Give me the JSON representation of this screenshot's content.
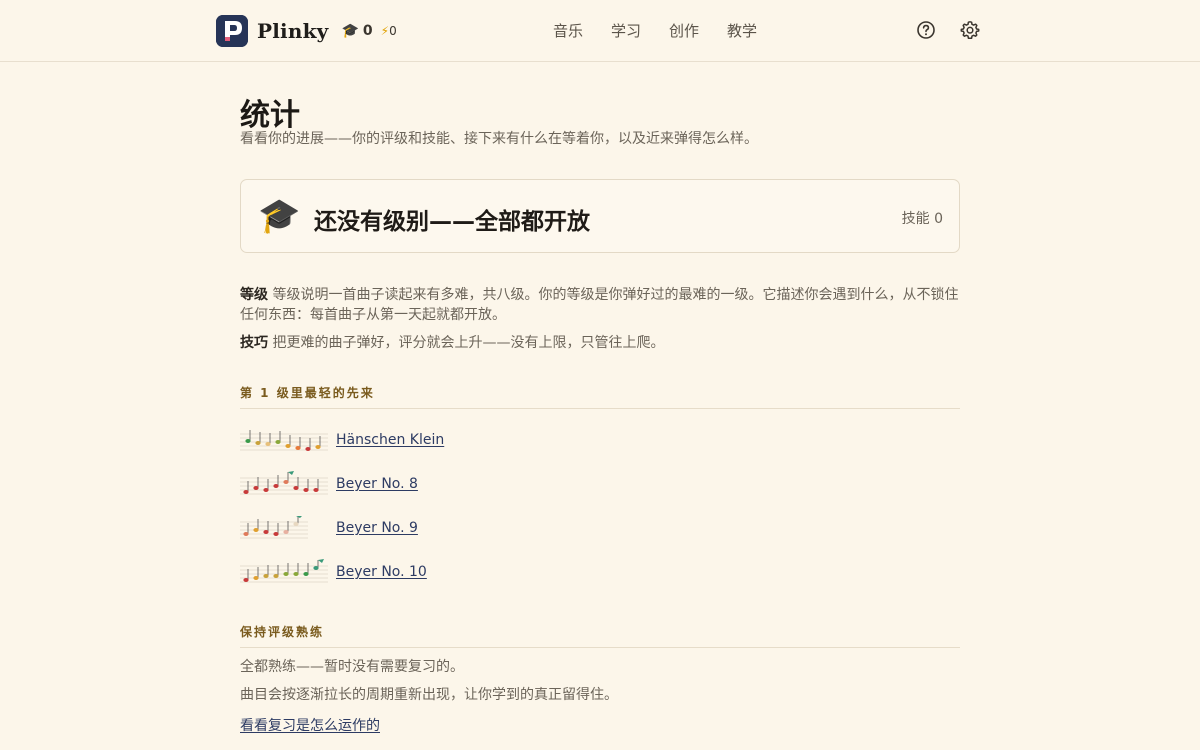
{
  "brand": {
    "name": "Plinky",
    "grade_count": "0",
    "energy_count": "0"
  },
  "nav": [
    "音乐",
    "学习",
    "创作",
    "教学"
  ],
  "page": {
    "title": "统计",
    "subtitle": "看看你的进展——你的评级和技能、接下来有什么在等着你，以及近来弹得怎么样。"
  },
  "level_card": {
    "status": "还没有级别——全部都开放",
    "skill_label": "技能 0"
  },
  "explain": {
    "grade_term": "等级",
    "grade_text": " 等级说明一首曲子读起来有多难，共八级。你的等级是你弹好过的最难的一级。它描述你会遇到什么，从不锁住任何东西：每首曲子从第一天起就都开放。",
    "skill_term": "技巧",
    "skill_text": " 把更难的曲子弹好，评分就会上升——没有上限，只管往上爬。"
  },
  "section_next": {
    "heading": "第 1 级里最轻的先来",
    "pieces": [
      {
        "title": "Hänschen Klein",
        "thumb": "staff-thumbnail"
      },
      {
        "title": "Beyer No. 8",
        "thumb": "staff-thumbnail"
      },
      {
        "title": "Beyer No. 9",
        "thumb": "staff-thumbnail"
      },
      {
        "title": "Beyer No. 10",
        "thumb": "staff-thumbnail"
      }
    ]
  },
  "section_review": {
    "heading": "保持评级熟练",
    "line1": "全都熟练——暂时没有需要复习的。",
    "line2": "曲目会按逐渐拉长的周期重新出现，让你学到的真正留得住。",
    "link": "看看复习是怎么运作的"
  },
  "colors": {
    "background": "#fcf6ea",
    "accent": "#263457",
    "section_heading": "#7a5b1e"
  }
}
